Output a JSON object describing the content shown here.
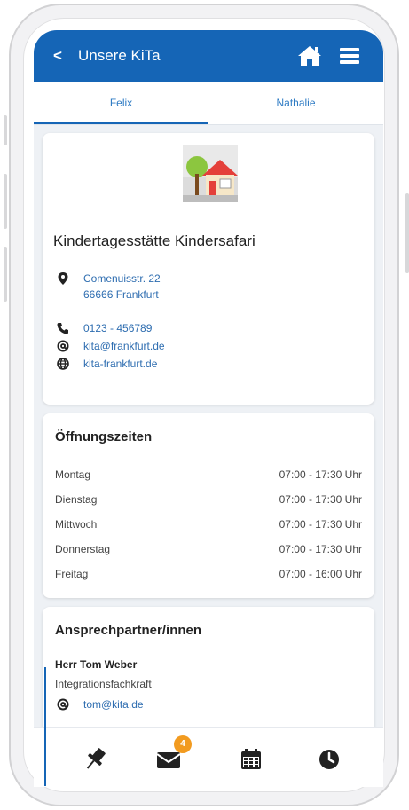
{
  "header": {
    "back_glyph": "<",
    "title": "Unsere KiTa",
    "home_icon": "home-icon",
    "menu_icon": "menu-icon"
  },
  "tabs": [
    {
      "label": "Felix",
      "active": true
    },
    {
      "label": "Nathalie",
      "active": false
    }
  ],
  "kita": {
    "logo": "kita-house-logo",
    "name": "Kindertagesstätte Kindersafari",
    "street": "Comenuisstr. 22",
    "city": "66666 Frankfurt",
    "phone": "0123 - 456789",
    "email": "kita@frankfurt.de",
    "website": "kita-frankfurt.de"
  },
  "opening_hours": {
    "title": "Öffnungszeiten",
    "rows": [
      {
        "day": "Montag",
        "time": "07:00 - 17:30 Uhr"
      },
      {
        "day": "Dienstag",
        "time": "07:00 - 17:30 Uhr"
      },
      {
        "day": "Mittwoch",
        "time": "07:00 - 17:30 Uhr"
      },
      {
        "day": "Donnerstag",
        "time": "07:00 - 17:30 Uhr"
      },
      {
        "day": "Freitag",
        "time": "07:00 - 16:00 Uhr"
      }
    ]
  },
  "contacts": {
    "title": "Ansprechpartner/innen",
    "person": {
      "name": "Herr Tom Weber",
      "role": "Integrationsfachkraft",
      "email": "tom@kita.de"
    }
  },
  "bottom_nav": {
    "items": [
      "pin-icon",
      "mail-icon",
      "calendar-icon",
      "clock-icon"
    ],
    "mail_badge": "4"
  },
  "colors": {
    "primary": "#1565b6",
    "link": "#2e6db0",
    "badge": "#f29b20",
    "background": "#eef1f5"
  }
}
